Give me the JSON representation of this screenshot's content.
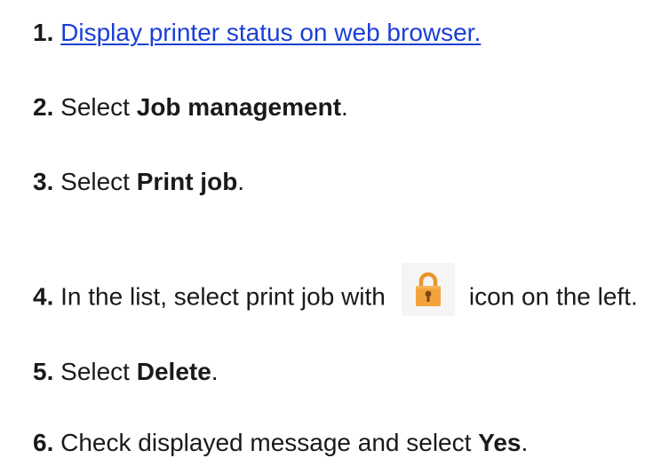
{
  "steps": [
    {
      "number": "1.",
      "link": "Display printer status on web browser."
    },
    {
      "number": "2.",
      "pre": "Select ",
      "bold": "Job management",
      "post": "."
    },
    {
      "number": "3.",
      "pre": "Select ",
      "bold": "Print job",
      "post": "."
    },
    {
      "number": "4.",
      "pre": "In the list, select print job with",
      "icon": "lock-icon",
      "post": "icon on the left."
    },
    {
      "number": "5.",
      "pre": "Select ",
      "bold": "Delete",
      "post": "."
    },
    {
      "number": "6.",
      "pre": "Check displayed message and select ",
      "bold": "Yes",
      "post": "."
    }
  ],
  "colors": {
    "link": "#1a3fd6",
    "text": "#1a1a1a",
    "lock_body": "#f4a23c",
    "lock_shackle": "#e8952c"
  }
}
